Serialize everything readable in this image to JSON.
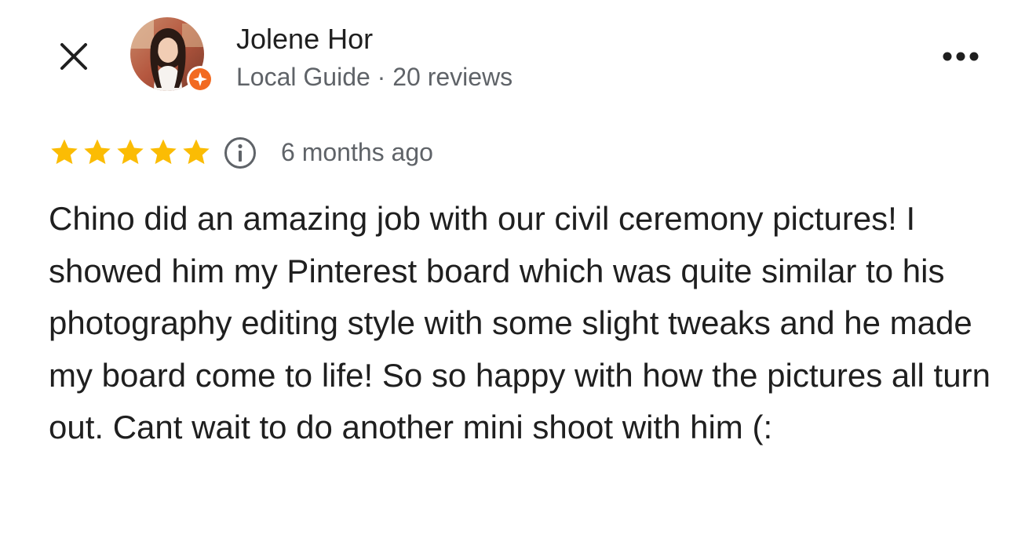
{
  "header": {
    "close_icon": "close-icon",
    "more_icon": "more-horizontal-icon"
  },
  "reviewer": {
    "name": "Jolene Hor",
    "meta": "Local Guide · 20 reviews",
    "badge_icon": "local-guide-star-icon",
    "badge_color": "#f26a21"
  },
  "review": {
    "rating": 5,
    "rating_max": 5,
    "star_color": "#fbbc04",
    "date": "6 months ago",
    "info_icon": "info-icon",
    "text": "Chino did an amazing job with our civil ceremony pictures! I showed him my Pinterest board which was quite similar to his photography editing style with some slight tweaks and he made my board come to life! So so happy with how the pictures all turn out. Cant wait to do another mini shoot with him (:"
  }
}
